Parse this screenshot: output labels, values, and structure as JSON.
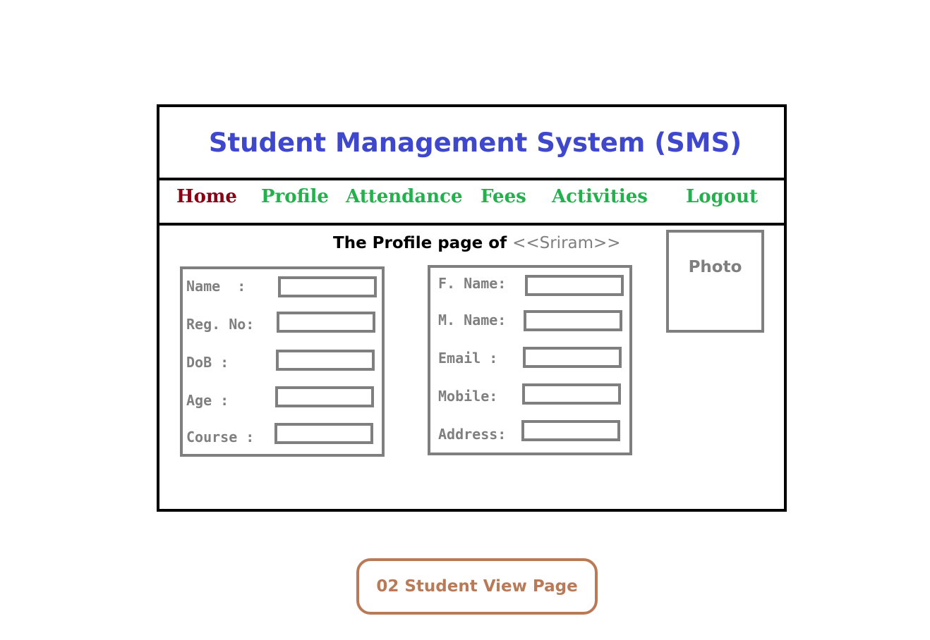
{
  "colors": {
    "title": "#3f48cc",
    "nav_active": "#880015",
    "nav_inactive": "#22b14c",
    "field_gray": "#7f7f7f",
    "caption": "#b97a57",
    "border": "#000000"
  },
  "header": {
    "title": "Student Management System (SMS)"
  },
  "nav": {
    "items": [
      {
        "label": "Home",
        "active": true
      },
      {
        "label": "Profile",
        "active": false
      },
      {
        "label": "Attendance",
        "active": false
      },
      {
        "label": "Fees",
        "active": false
      },
      {
        "label": "Activities",
        "active": false
      },
      {
        "label": "Logout",
        "active": false
      }
    ]
  },
  "profile": {
    "heading_prefix": "The Profile page of ",
    "student_name": "<<Sriram>>",
    "photo_label": "Photo"
  },
  "left_fields": [
    {
      "label": "Name  :",
      "value": ""
    },
    {
      "label": "Reg. No:",
      "value": ""
    },
    {
      "label": "DoB :",
      "value": ""
    },
    {
      "label": "Age :",
      "value": ""
    },
    {
      "label": "Course :",
      "value": ""
    }
  ],
  "right_fields": [
    {
      "label": "F. Name:",
      "value": ""
    },
    {
      "label": "M. Name:",
      "value": ""
    },
    {
      "label": "Email :",
      "value": ""
    },
    {
      "label": "Mobile:",
      "value": ""
    },
    {
      "label": "Address:",
      "value": ""
    }
  ],
  "caption": {
    "text": "02 Student View Page"
  }
}
